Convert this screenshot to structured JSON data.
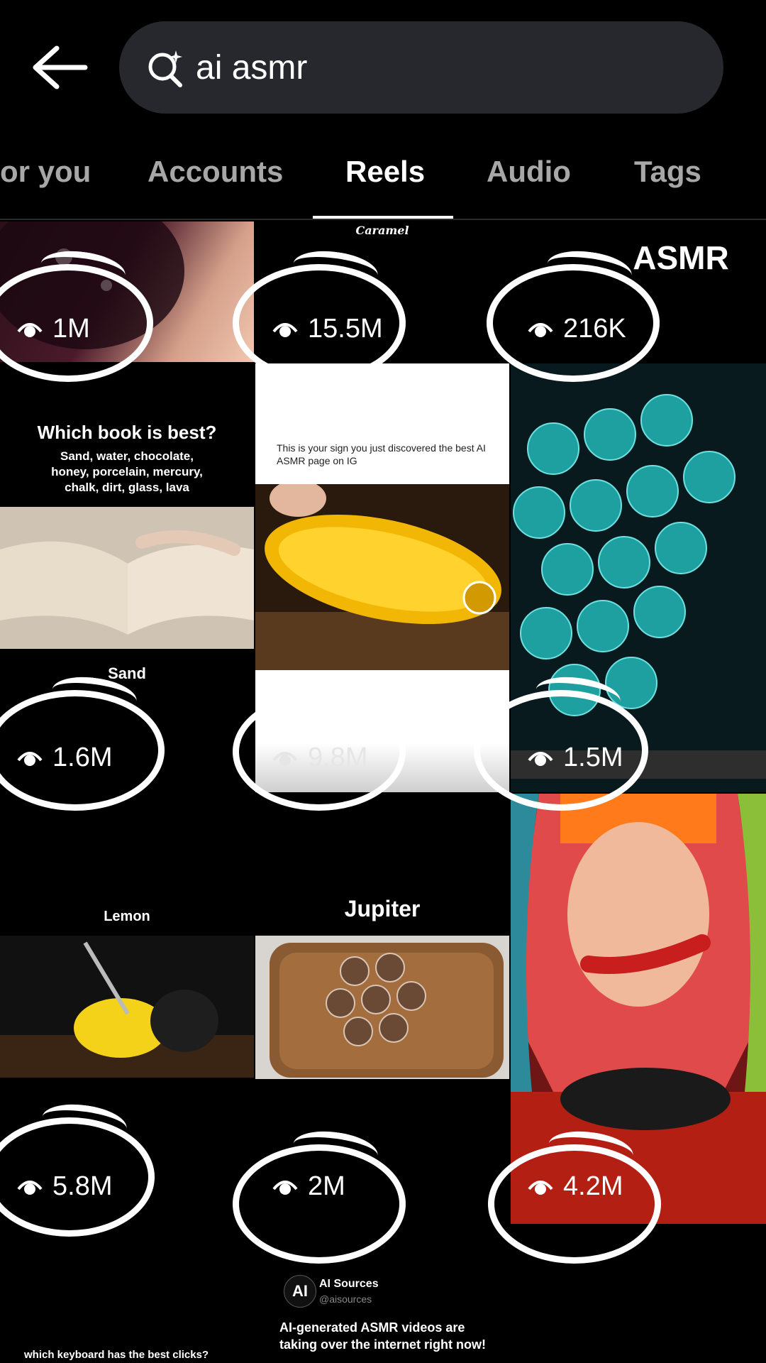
{
  "search": {
    "query": "ai asmr"
  },
  "tabs": [
    {
      "label": "or you"
    },
    {
      "label": "Accounts"
    },
    {
      "label": "Reels"
    },
    {
      "label": "Audio"
    },
    {
      "label": "Tags"
    }
  ],
  "reels": [
    {
      "views": "1M",
      "overlay": ""
    },
    {
      "views": "15.5M",
      "overlay": "Caramel"
    },
    {
      "views": "216K",
      "overlay": "ASMR"
    },
    {
      "views": "1.6M",
      "overlay": "Sand",
      "heading": "Which book is best?",
      "subheading": "Sand, water, chocolate, honey, porcelain, mercury, chalk, dirt, glass, lava"
    },
    {
      "views": "9.8M",
      "overlay": "This is your sign you just discovered the best AI ASMR page on IG"
    },
    {
      "views": "1.5M",
      "overlay": ""
    },
    {
      "views": "5.8M",
      "overlay": "Lemon"
    },
    {
      "views": "2M",
      "overlay": "Jupiter"
    },
    {
      "views": "4.2M",
      "overlay": ""
    }
  ],
  "footer": {
    "account_name": "AI Sources",
    "handle": "@aisources",
    "avatar_text": "AI",
    "post_text": "AI-generated ASMR videos are taking over the internet right now!",
    "left_caption": "which keyboard has the best clicks?"
  },
  "colors": {
    "background": "#000000",
    "search_bg": "#26282d",
    "tab_inactive": "#a7a7a7",
    "accent": "#ffffff"
  }
}
